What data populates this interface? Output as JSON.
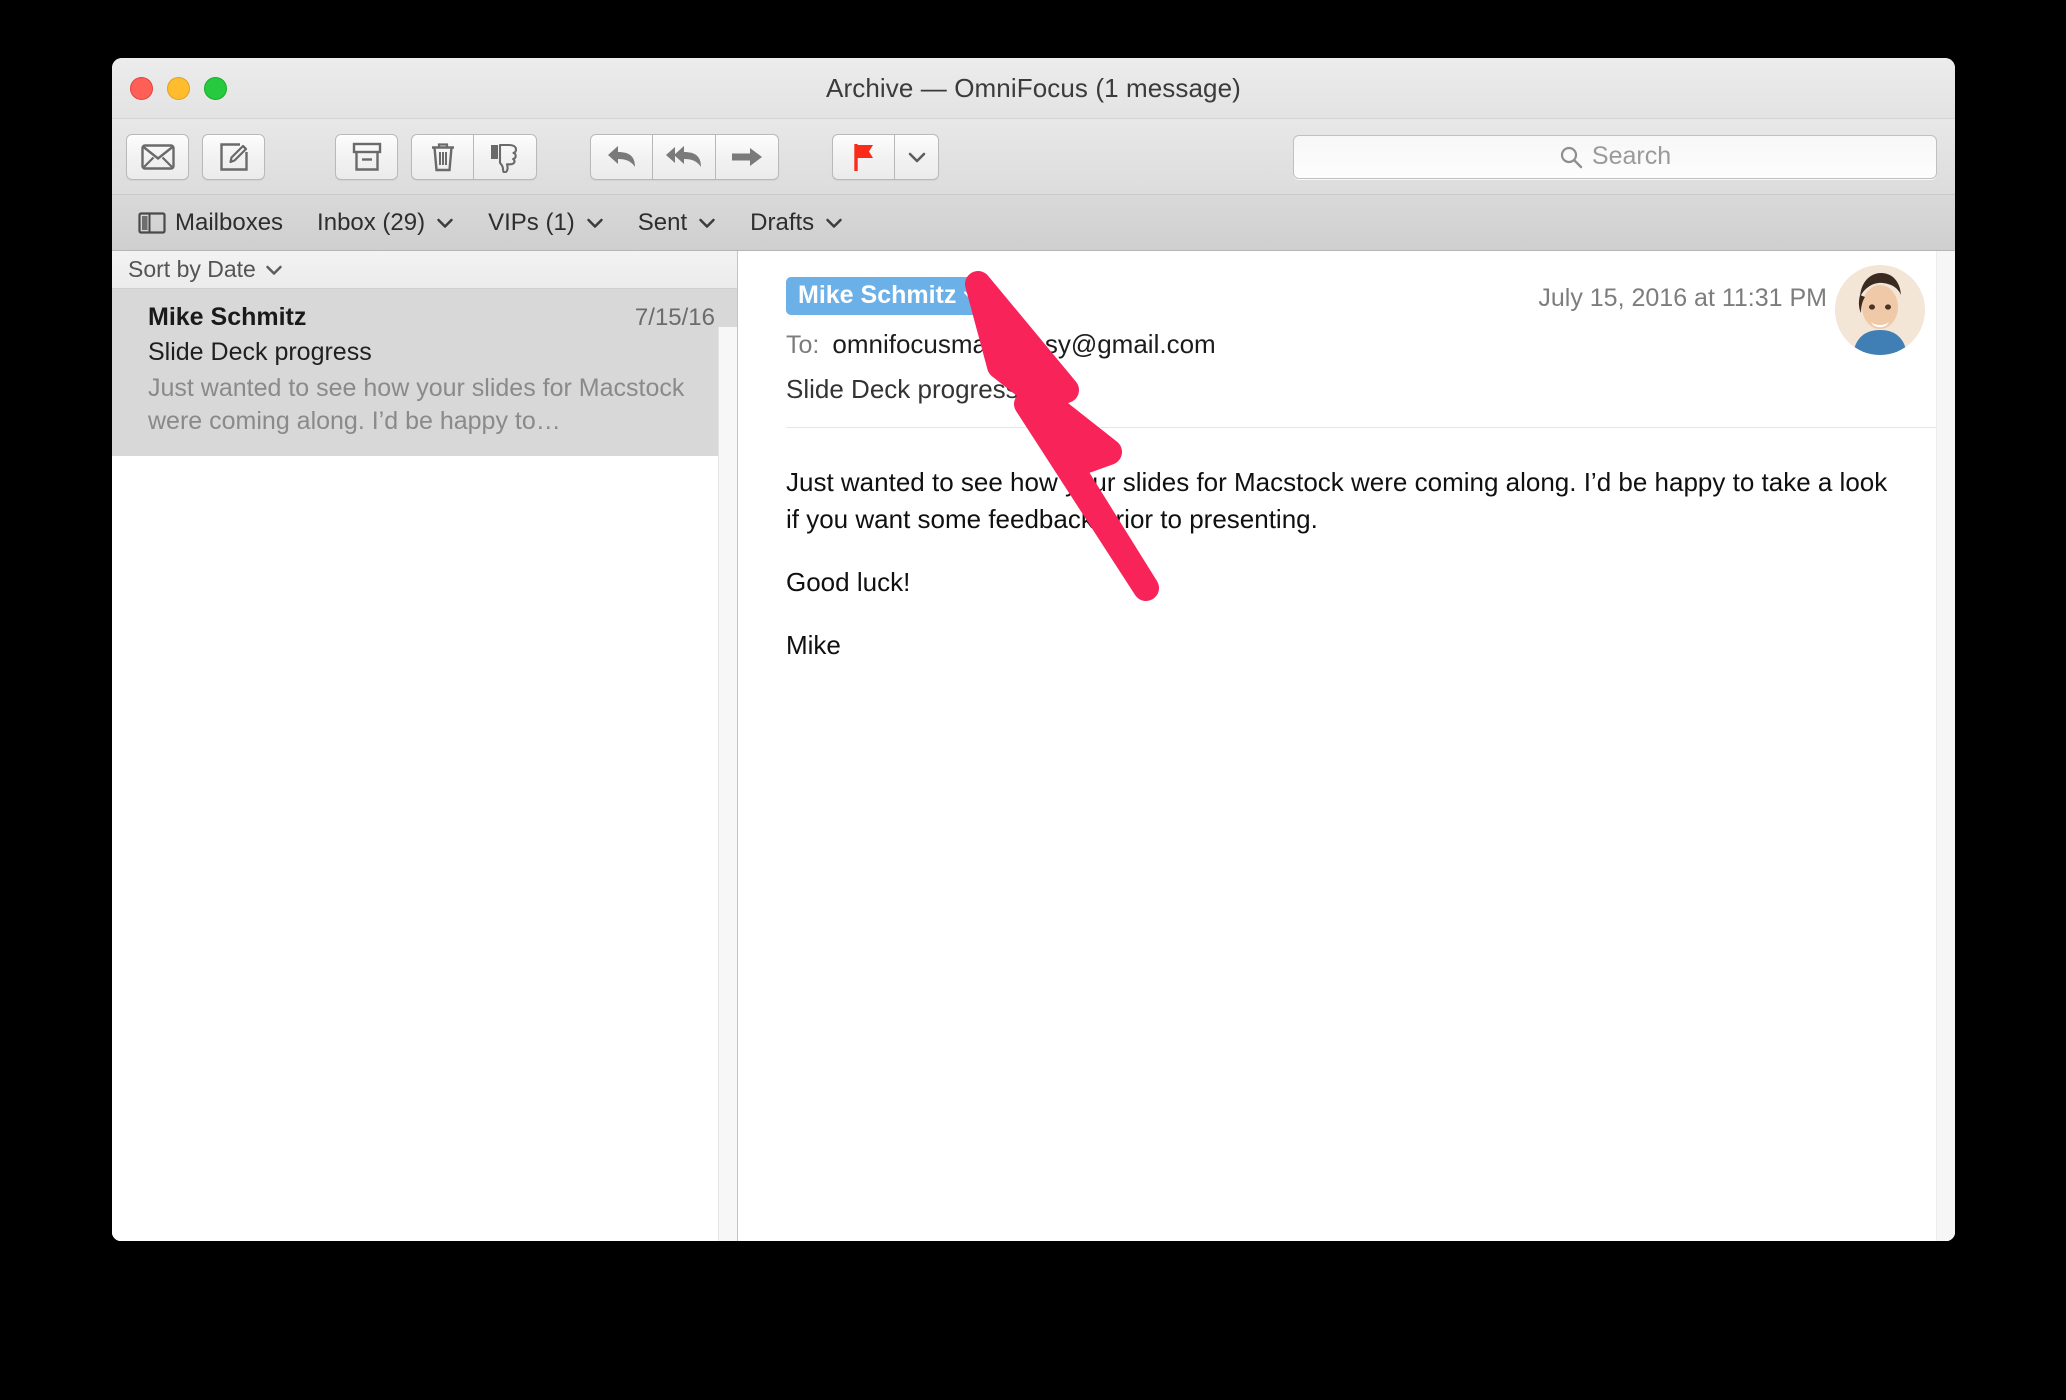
{
  "window": {
    "title": "Archive — OmniFocus (1 message)",
    "traffic_lights": [
      {
        "name": "close",
        "color": "#ff5f56"
      },
      {
        "name": "minimize",
        "color": "#ffbd2e"
      },
      {
        "name": "zoom",
        "color": "#27c93f"
      }
    ]
  },
  "toolbar": {
    "buttons": [
      {
        "name": "get-mail",
        "icon": "envelope-icon",
        "label": "Get Mail"
      },
      {
        "name": "compose",
        "icon": "compose-icon",
        "label": "New Message"
      },
      {
        "name": "archive",
        "icon": "archive-box-icon",
        "label": "Archive"
      },
      {
        "name": "delete",
        "icon": "trash-icon",
        "label": "Delete"
      },
      {
        "name": "junk",
        "icon": "thumbs-down-icon",
        "label": "Junk"
      },
      {
        "name": "reply",
        "icon": "reply-arrow-icon",
        "label": "Reply"
      },
      {
        "name": "reply-all",
        "icon": "reply-all-arrow-icon",
        "label": "Reply All"
      },
      {
        "name": "forward",
        "icon": "forward-arrow-icon",
        "label": "Forward"
      },
      {
        "name": "flag",
        "icon": "flag-icon",
        "label": "Flag"
      },
      {
        "name": "flag-menu",
        "icon": "chevron-down-icon",
        "label": "Flag Options"
      }
    ],
    "flag_color": "#fa2c19"
  },
  "search": {
    "placeholder": "Search",
    "value": "",
    "icon": "search-icon"
  },
  "favorites_bar": {
    "items": [
      {
        "name": "mailboxes",
        "label": "Mailboxes",
        "icon": "sidebar-toggle-icon",
        "has_chevron": false
      },
      {
        "name": "inbox",
        "label": "Inbox (29)",
        "has_chevron": true
      },
      {
        "name": "vips",
        "label": "VIPs (1)",
        "has_chevron": true
      },
      {
        "name": "sent",
        "label": "Sent",
        "has_chevron": true
      },
      {
        "name": "drafts",
        "label": "Drafts",
        "has_chevron": true
      }
    ]
  },
  "message_list": {
    "sort_label": "Sort by Date",
    "sort_chevron": "chevron-down-icon",
    "messages": [
      {
        "sender": "Mike Schmitz",
        "date": "7/15/16",
        "subject": "Slide Deck progress",
        "preview": "Just wanted to see how your slides for Macstock were coming along. I’d be happy to…",
        "selected": true
      }
    ]
  },
  "message": {
    "sender_badge": "Mike Schmitz",
    "sender_badge_chevron": "chevron-down-icon",
    "sender_badge_color": "#6cb0e8",
    "date": "July 15, 2016 at 11:31 PM",
    "to_label": "To:",
    "to_value": "omnifocusmadeeasy@gmail.com",
    "subject": "Slide Deck progress",
    "avatar": "contact-photo",
    "body": [
      "Just wanted to see how your slides for Macstock were coming along. I’d be happy to take a look if you want some feedback prior to presenting.",
      "Good luck!",
      "Mike"
    ]
  },
  "annotation": {
    "arrow_color": "#f72359",
    "name": "pointer-arrow"
  }
}
